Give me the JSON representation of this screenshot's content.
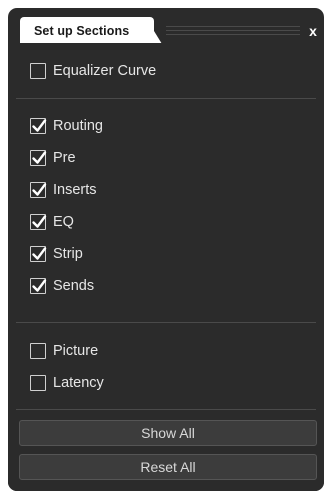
{
  "panel": {
    "tab_title": "Set up Sections",
    "close_label": "x"
  },
  "groups": [
    {
      "items": [
        {
          "label": "Equalizer Curve",
          "checked": false
        }
      ]
    },
    {
      "items": [
        {
          "label": "Routing",
          "checked": true
        },
        {
          "label": "Pre",
          "checked": true
        },
        {
          "label": "Inserts",
          "checked": true
        },
        {
          "label": "EQ",
          "checked": true
        },
        {
          "label": "Strip",
          "checked": true
        },
        {
          "label": "Sends",
          "checked": true
        }
      ]
    },
    {
      "items": [
        {
          "label": "Picture",
          "checked": false
        },
        {
          "label": "Latency",
          "checked": false
        }
      ]
    }
  ],
  "buttons": {
    "show_all": "Show All",
    "reset_all": "Reset All"
  },
  "colors": {
    "panel_background": "#2b2b2b",
    "tab_background": "#ffffff",
    "text": "#e6e6e6",
    "checkbox_border": "#d0d0d0",
    "button_background": "#3c3c3c"
  },
  "icons": {
    "close": "close-icon",
    "check": "checkmark-icon"
  }
}
